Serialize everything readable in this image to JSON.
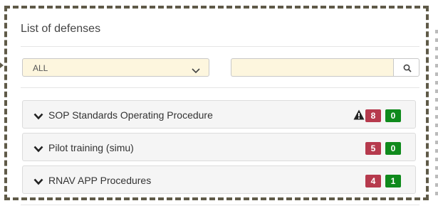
{
  "panel": {
    "title": "List of defenses"
  },
  "filter": {
    "selected": "ALL",
    "search_value": "",
    "search_placeholder": ""
  },
  "colors": {
    "alert": "#b63a4d",
    "ok": "#0f8a1c",
    "field_bg": "#fdf6de",
    "frame": "#5f5a48"
  },
  "icons": {
    "select_toggle": "chevron-down-icon",
    "search": "search-icon",
    "row_toggle": "chevron-down-icon",
    "warning": "warning-triangle-icon"
  },
  "defenses": [
    {
      "name": "SOP Standards Operating Procedure",
      "alert_count": "8",
      "ok_count": "0",
      "warning": true
    },
    {
      "name": "Pilot training (simu)",
      "alert_count": "5",
      "ok_count": "0",
      "warning": false
    },
    {
      "name": "RNAV APP Procedures",
      "alert_count": "4",
      "ok_count": "1",
      "warning": false
    }
  ]
}
